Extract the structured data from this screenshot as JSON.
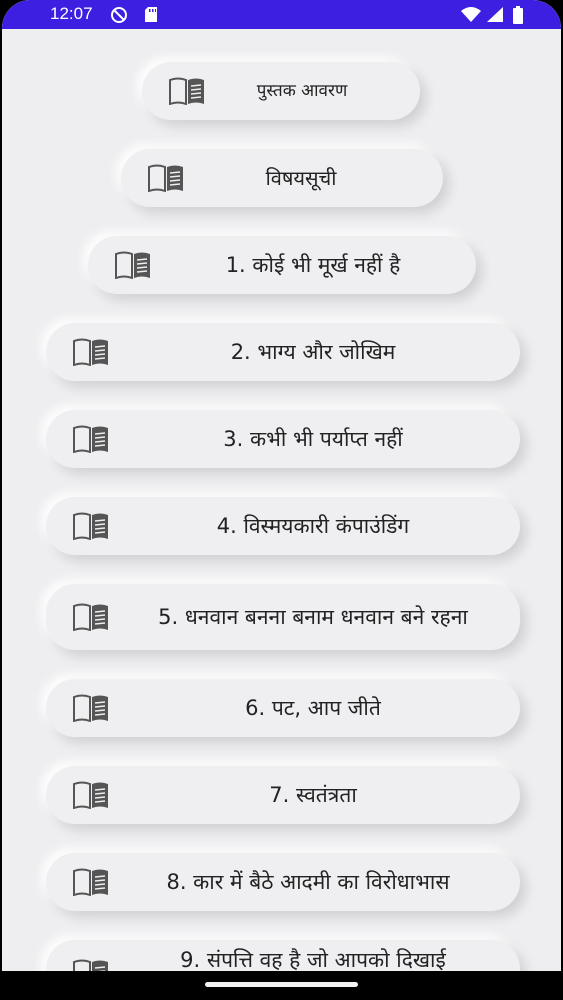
{
  "status_bar": {
    "time": "12:07",
    "background": "#3c1fe0",
    "left_icons": [
      "no-disturb-icon",
      "sd-card-icon"
    ],
    "right_icons": [
      "wifi-icon",
      "signal-icon",
      "battery-icon"
    ]
  },
  "chapters": [
    {
      "label": "पुस्तक आवरण"
    },
    {
      "label": "विषयसूची"
    },
    {
      "label": "1. कोई भी मूर्ख नहीं है"
    },
    {
      "label": "2. भाग्य और जोखिम"
    },
    {
      "label": "3. कभी भी पर्याप्त नहीं"
    },
    {
      "label": "4. विस्मयकारी कंपाउंडिंग"
    },
    {
      "label": "5. धनवान बनना बनाम धनवान बने रहना"
    },
    {
      "label": "6. पट, आप जीते"
    },
    {
      "label": "7. स्वतंत्रता"
    },
    {
      "label": "8. कार में बैठे आदमी का विरोधाभास"
    },
    {
      "label": "9. संपत्ति वह है जो आपको दिखाई"
    }
  ],
  "icons": {
    "chapter": "book-icon"
  }
}
